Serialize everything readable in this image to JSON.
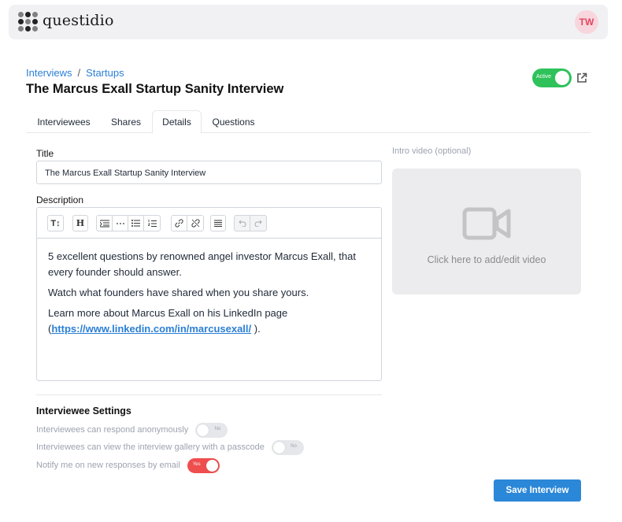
{
  "header": {
    "brand": "questidio",
    "avatar_initials": "TW"
  },
  "breadcrumb": {
    "item1": "Interviews",
    "separator": "/",
    "item2": "Startups"
  },
  "page_title": "The Marcus Exall Startup Sanity Interview",
  "status_toggle": {
    "label": "Active",
    "on": true
  },
  "tabs": [
    {
      "label": "Interviewees"
    },
    {
      "label": "Shares"
    },
    {
      "label": "Details",
      "active": true
    },
    {
      "label": "Questions"
    }
  ],
  "form": {
    "title_label": "Title",
    "title_value": "The Marcus Exall Startup Sanity Interview",
    "description_label": "Description",
    "toolbar": {
      "text_size": "T↕",
      "heading": "H"
    },
    "description": {
      "p1": "5 excellent questions by renowned angel investor Marcus Exall, that every founder should answer.",
      "p2": "Watch what founders have shared when you share yours.",
      "p3_before": "Learn more about Marcus Exall on his LinkedIn page (",
      "p3_link": "https://www.linkedin.com/in/marcusexall/",
      "p3_after": " )."
    }
  },
  "video": {
    "label": "Intro video (optional)",
    "placeholder": "Click here to add/edit video"
  },
  "settings": {
    "title": "Interviewee Settings",
    "items": [
      {
        "label": "Interviewees can respond anonymously",
        "state": "No"
      },
      {
        "label": "Interviewees can view the interview gallery with a passcode",
        "state": "No"
      },
      {
        "label": "Notify me on new responses by email",
        "state": "Yes"
      }
    ]
  },
  "save_button": "Save Interview",
  "colors": {
    "accent": "#2b87d8",
    "active_green": "#2fc25b",
    "toggle_on": "#ef4e4e",
    "avatar_bg": "#f7d7dd"
  }
}
